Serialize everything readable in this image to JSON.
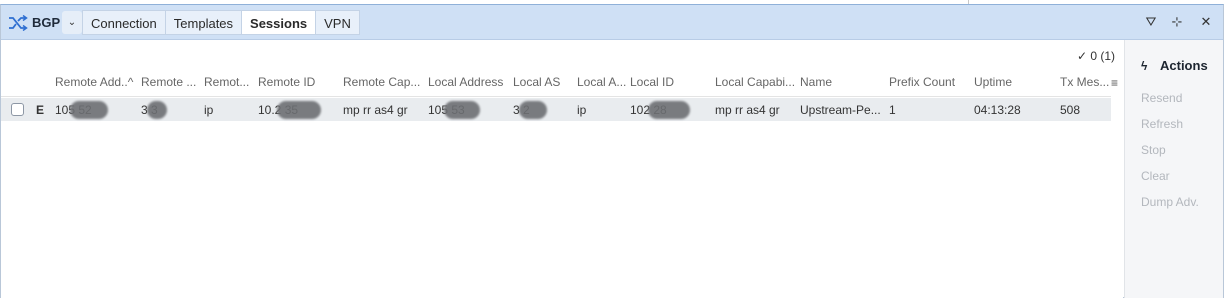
{
  "app": {
    "title": "BGP",
    "dropdown_glyph": "⌄",
    "icon": "shuffle-icon"
  },
  "tabs": [
    {
      "label": "Connection",
      "active": false
    },
    {
      "label": "Templates",
      "active": false
    },
    {
      "label": "Sessions",
      "active": true
    },
    {
      "label": "VPN",
      "active": false
    }
  ],
  "header_buttons": {
    "filter_glyph": "⛛",
    "pin_glyph": "⊹",
    "close_glyph": "✕"
  },
  "count": "✓ 0 (1)",
  "columns": [
    {
      "label": "Remote Add..^"
    },
    {
      "label": "Remote ..."
    },
    {
      "label": "Remot..."
    },
    {
      "label": "Remote ID"
    },
    {
      "label": "Remote Cap..."
    },
    {
      "label": "Local Address"
    },
    {
      "label": "Local AS"
    },
    {
      "label": "Local A..."
    },
    {
      "label": "Local ID"
    },
    {
      "label": "Local Capabi..."
    },
    {
      "label": "Name"
    },
    {
      "label": "Prefix Count"
    },
    {
      "label": "Uptime"
    },
    {
      "label": "Tx Mes..."
    }
  ],
  "column_menu_glyph": "≡",
  "rows": [
    {
      "flag": "E",
      "remote_address": "105      52",
      "remote_as": "3   3",
      "remote_afi": "ip",
      "remote_id": "10.2       35",
      "remote_cap": "mp rr as4 gr",
      "local_address": "105      53",
      "local_as": "3   2",
      "local_afi": "ip",
      "local_id": "102       28",
      "local_cap": "mp rr as4 gr",
      "name": "Upstream-Pe...",
      "prefix_count": "1",
      "uptime": "04:13:28",
      "tx_messages": "508"
    }
  ],
  "actions": {
    "title": "Actions",
    "icon_glyph": "ϟ",
    "items": [
      "Resend",
      "Refresh",
      "Stop",
      "Clear",
      "Dump Adv."
    ]
  }
}
